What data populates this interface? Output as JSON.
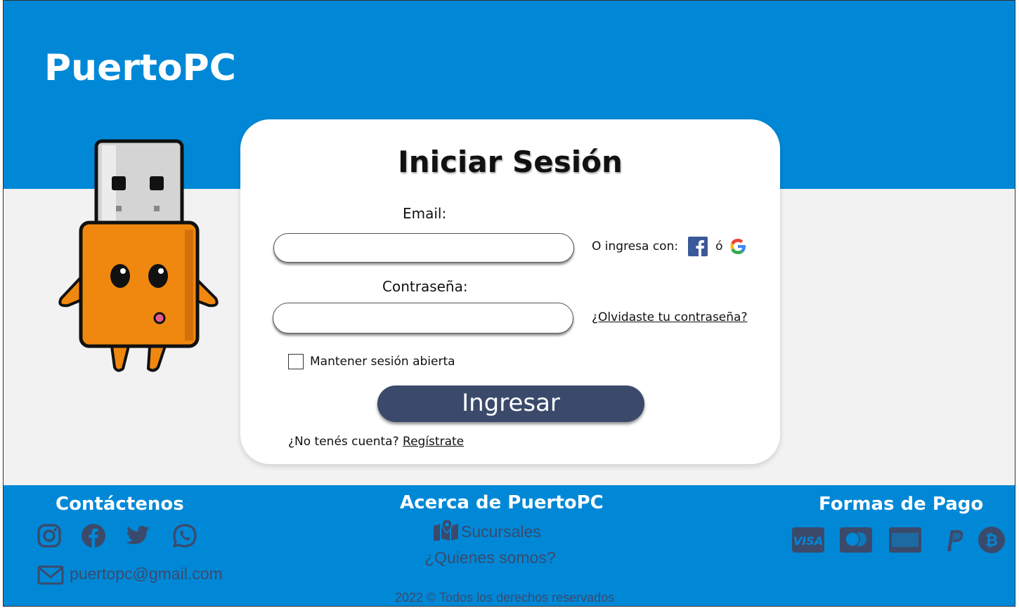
{
  "header": {
    "brand": "PuertoPC"
  },
  "login": {
    "title": "Iniciar Sesión",
    "email_label": "Email:",
    "email_value": "",
    "password_label": "Contraseña:",
    "password_value": "",
    "alt_login_text": "O ingresa con:",
    "alt_login_or": "ó",
    "forgot_link": "¿Olvidaste tu contraseña?",
    "remember_label": "Mantener sesión abierta",
    "submit_label": "Ingresar",
    "no_account_text": "¿No tenés cuenta?",
    "register_link": "Regístrate"
  },
  "footer": {
    "contact_title": "Contáctenos",
    "email": "puertopc@gmail.com",
    "about_title": "Acerca de PuertoPC",
    "branches_link": "Sucursales",
    "about_link": "¿Quienes somos?",
    "payments_title": "Formas de Pago",
    "copyright": "2022 © Todos los derechos reservados"
  },
  "colors": {
    "primary_blue": "#0088d7",
    "button_navy": "#3b4a6b",
    "background_gray": "#f2f2f2",
    "mascot_orange": "#f0880f"
  },
  "icons": [
    "facebook-icon",
    "google-icon",
    "instagram-icon",
    "twitter-icon",
    "whatsapp-icon",
    "mail-icon",
    "map-icon",
    "visa-icon",
    "mastercard-icon",
    "amex-icon",
    "paypal-icon",
    "bitcoin-icon"
  ]
}
